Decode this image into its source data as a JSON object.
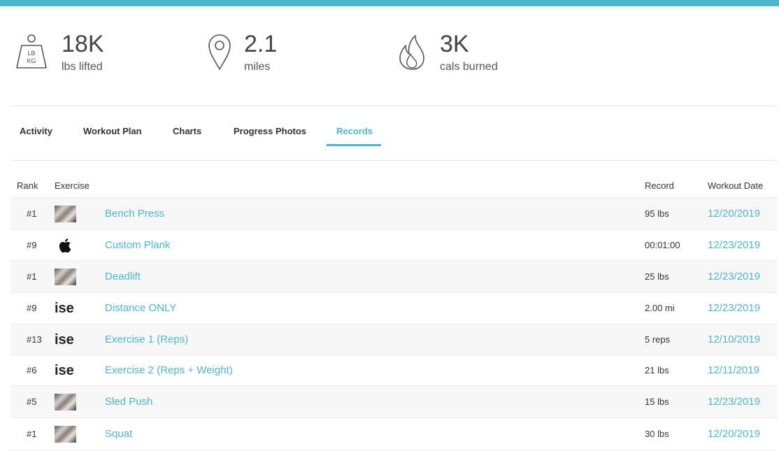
{
  "stats": [
    {
      "icon": "weight-icon",
      "value": "18K",
      "label": "lbs lifted",
      "icon_text_top": "LB",
      "icon_text_bottom": "KG"
    },
    {
      "icon": "location-pin-icon",
      "value": "2.1",
      "label": "miles"
    },
    {
      "icon": "flame-icon",
      "value": "3K",
      "label": "cals burned"
    }
  ],
  "tabs": [
    {
      "label": "Activity",
      "active": false
    },
    {
      "label": "Workout Plan",
      "active": false
    },
    {
      "label": "Charts",
      "active": false
    },
    {
      "label": "Progress Photos",
      "active": false
    },
    {
      "label": "Records",
      "active": true
    }
  ],
  "table": {
    "headers": {
      "rank": "Rank",
      "exercise": "Exercise",
      "record": "Record",
      "date": "Workout Date"
    },
    "rows": [
      {
        "rank": "#1",
        "thumb": "photo",
        "exercise": "Bench Press",
        "record": "95 lbs",
        "date": "12/20/2019"
      },
      {
        "rank": "#9",
        "thumb": "apple",
        "exercise": "Custom Plank",
        "record": "00:01:00",
        "date": "12/23/2019"
      },
      {
        "rank": "#1",
        "thumb": "photo",
        "exercise": "Deadlift",
        "record": "25 lbs",
        "date": "12/23/2019"
      },
      {
        "rank": "#9",
        "thumb": "text",
        "exercise": "Distance ONLY",
        "record": "2.00 mi",
        "date": "12/23/2019"
      },
      {
        "rank": "#13",
        "thumb": "text",
        "exercise": "Exercise 1 (Reps)",
        "record": "5 reps",
        "date": "12/10/2019"
      },
      {
        "rank": "#6",
        "thumb": "text",
        "exercise": "Exercise 2 (Reps + Weight)",
        "record": "21 lbs",
        "date": "12/11/2019"
      },
      {
        "rank": "#5",
        "thumb": "photo",
        "exercise": "Sled Push",
        "record": "15 lbs",
        "date": "12/23/2019"
      },
      {
        "rank": "#1",
        "thumb": "photo",
        "exercise": "Squat",
        "record": "30 lbs",
        "date": "12/20/2019"
      }
    ],
    "thumb_text": "ise"
  },
  "colors": {
    "accent": "#4db8c9",
    "row_alt": "#f7f7f7"
  }
}
